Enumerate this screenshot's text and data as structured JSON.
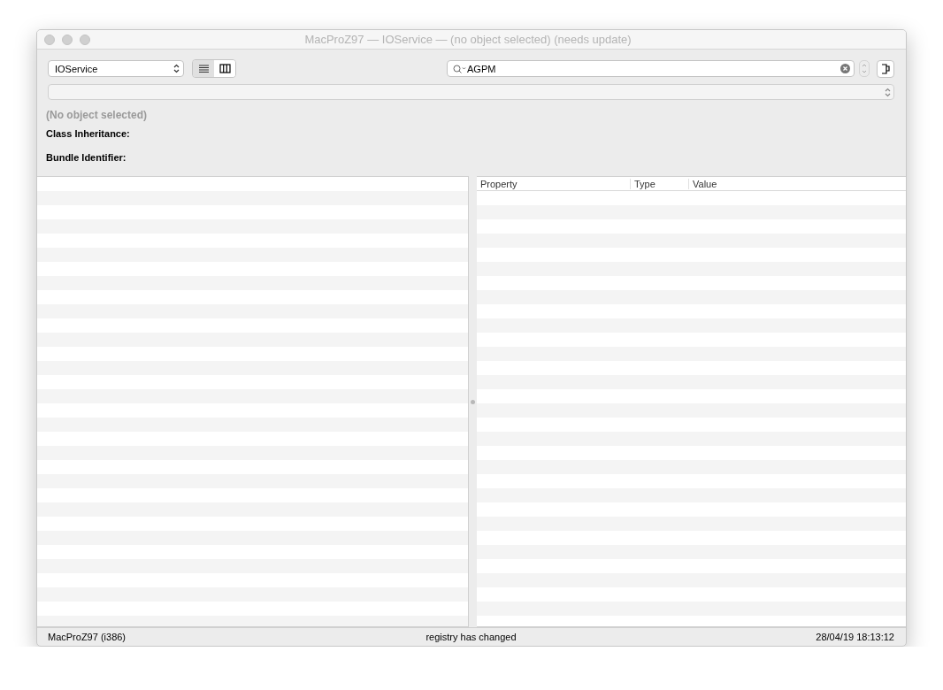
{
  "window": {
    "title": "MacProZ97 — IOService — (no object selected) (needs update)"
  },
  "toolbar": {
    "plane_popup": "IOService",
    "view_modes": [
      {
        "kind": "list",
        "selected": true
      },
      {
        "kind": "columns",
        "selected": false
      }
    ],
    "search": {
      "value": "AGPM"
    }
  },
  "info": {
    "heading": "(No object selected)",
    "labels": [
      "Class Inheritance:",
      "Bundle Identifier:"
    ]
  },
  "properties": {
    "columns": [
      "Property",
      "Type",
      "Value"
    ]
  },
  "status_bar": {
    "left": "MacProZ97 (i386)",
    "center": "registry has changed",
    "right": "28/04/19 18:13:12"
  }
}
